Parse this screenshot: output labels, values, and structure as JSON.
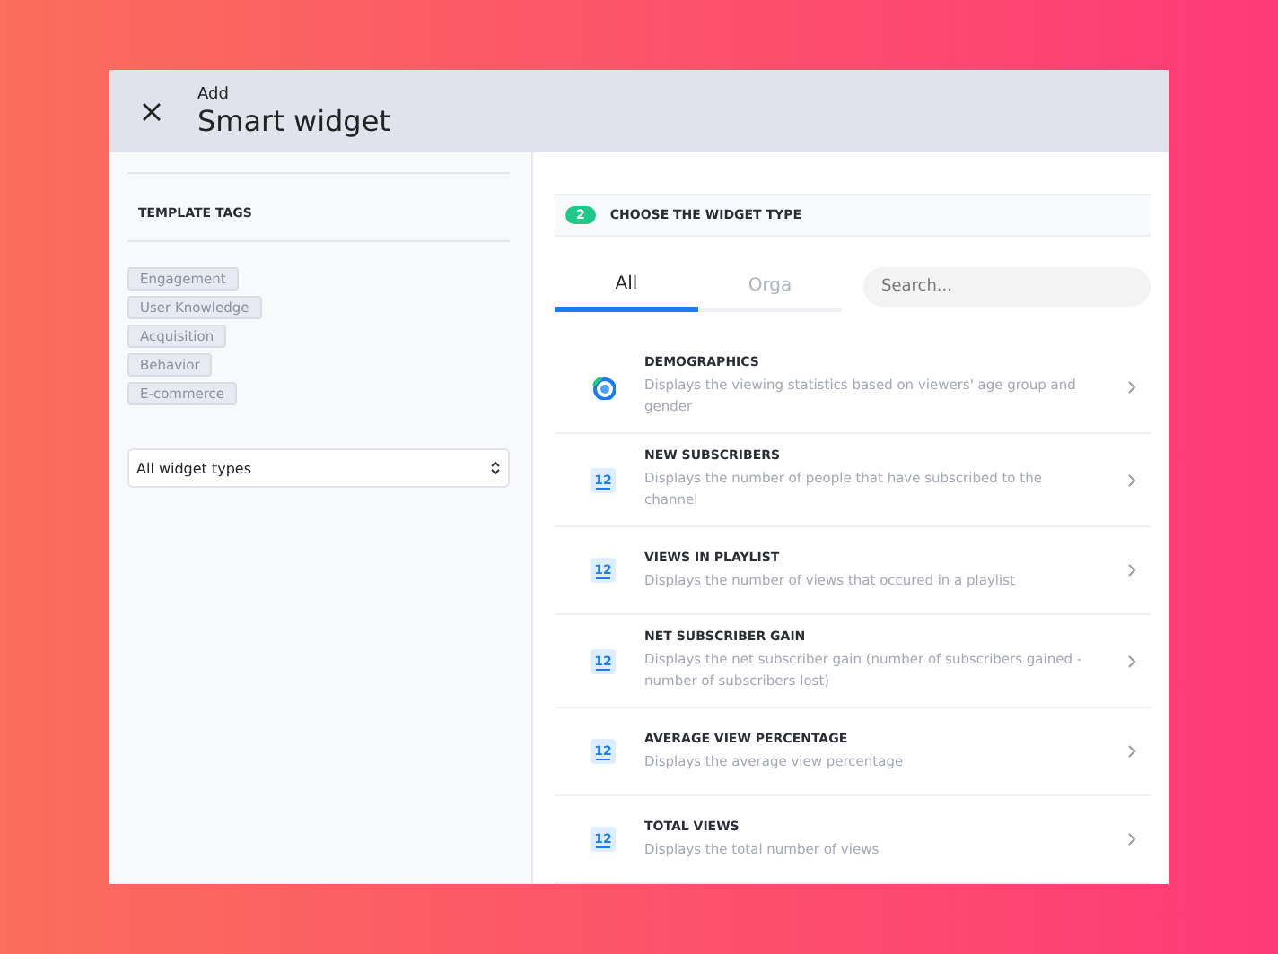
{
  "header": {
    "overline": "Add",
    "title": "Smart widget"
  },
  "sidebar": {
    "heading": "TEMPLATE TAGS",
    "tags": [
      "Engagement",
      "User Knowledge",
      "Acquisition",
      "Behavior",
      "E-commerce"
    ],
    "select": {
      "value": "All widget types"
    }
  },
  "step": {
    "number": "2",
    "title": "CHOOSE THE WIDGET TYPE"
  },
  "tabs": [
    {
      "label": "All",
      "selected": true
    },
    {
      "label": "Orga",
      "selected": false
    }
  ],
  "search": {
    "placeholder": "Search..."
  },
  "widgets": [
    {
      "title": "DEMOGRAPHICS",
      "description": "Displays the viewing statistics based on viewers' age group and gender",
      "icon": {
        "kind": "pie"
      }
    },
    {
      "title": "NEW SUBSCRIBERS",
      "description": "Displays the number of people that have subscribed to the channel",
      "icon": {
        "kind": "number",
        "label": "12"
      }
    },
    {
      "title": "VIEWS IN PLAYLIST",
      "description": "Displays the number of views that occured in a playlist",
      "icon": {
        "kind": "number",
        "label": "12"
      }
    },
    {
      "title": "NET SUBSCRIBER GAIN",
      "description": "Displays the net subscriber gain (number of subscribers gained - number of subscribers lost)",
      "icon": {
        "kind": "number",
        "label": "12"
      }
    },
    {
      "title": "AVERAGE VIEW PERCENTAGE",
      "description": "Displays the average view percentage",
      "icon": {
        "kind": "number",
        "label": "12"
      }
    },
    {
      "title": "TOTAL VIEWS",
      "description": "Displays the total number of views",
      "icon": {
        "kind": "number",
        "label": "12"
      }
    }
  ]
}
